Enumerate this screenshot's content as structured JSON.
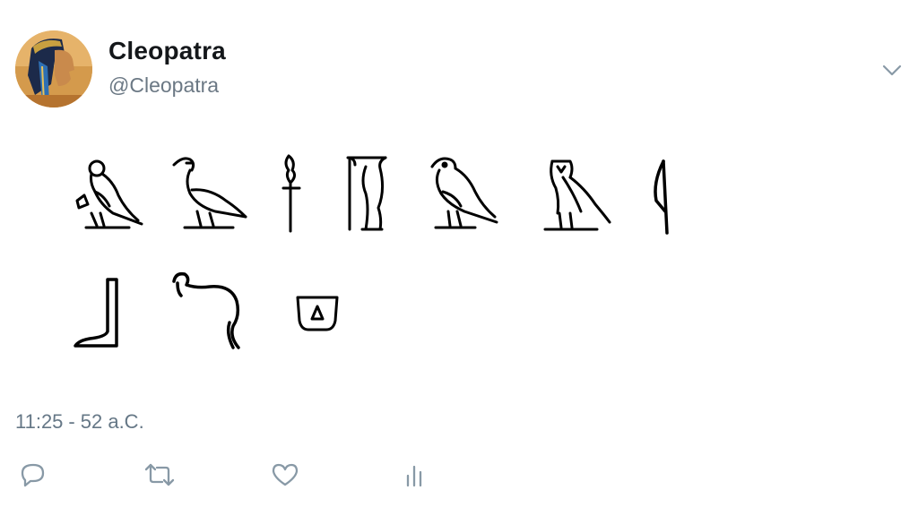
{
  "tweet": {
    "author": {
      "display_name": "Cleopatra",
      "handle": "@Cleopatra",
      "avatar_icon": "cleopatra-portrait-icon"
    },
    "menu_icon": "chevron-down-icon",
    "content_type": "egyptian-hieroglyphs",
    "hieroglyphs": [
      "vulture-icon",
      "duck-icon",
      "ankh-reed-icon",
      "column-icon",
      "falcon-icon",
      "owl-icon",
      "reed-leaf-icon",
      "leg-icon",
      "cobra-icon",
      "basket-icon"
    ],
    "timestamp": {
      "time": "11:25",
      "separator": "-",
      "date": "52 a.C."
    },
    "actions": [
      {
        "name": "reply",
        "icon": "reply-icon"
      },
      {
        "name": "retweet",
        "icon": "retweet-icon"
      },
      {
        "name": "like",
        "icon": "heart-icon"
      },
      {
        "name": "analytics",
        "icon": "analytics-icon"
      }
    ],
    "colors": {
      "text": "#14171a",
      "muted": "#657786",
      "icon": "#8899a6",
      "glyph": "#000000"
    }
  }
}
